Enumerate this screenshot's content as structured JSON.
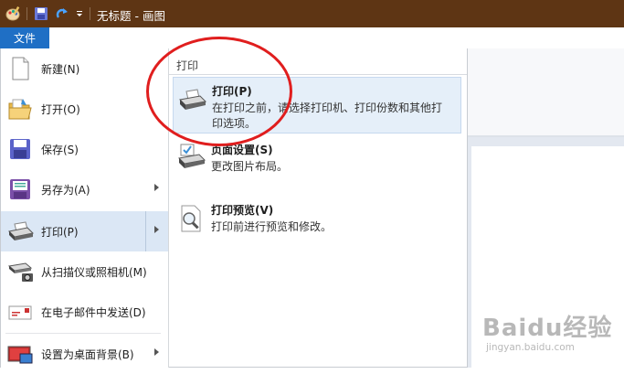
{
  "window": {
    "title": "无标题 - 画图"
  },
  "file_tab": {
    "label": "文件"
  },
  "menu_items": [
    {
      "label": "新建(N)",
      "icon": "new-document-icon"
    },
    {
      "label": "打开(O)",
      "icon": "open-folder-icon"
    },
    {
      "label": "保存(S)",
      "icon": "save-disk-icon"
    },
    {
      "label": "另存为(A)",
      "icon": "save-as-icon",
      "has_submenu": true
    },
    {
      "label": "打印(P)",
      "icon": "printer-icon",
      "has_submenu": true,
      "selected": true
    },
    {
      "label": "从扫描仪或照相机(M)",
      "icon": "scanner-camera-icon"
    },
    {
      "label": "在电子邮件中发送(D)",
      "icon": "email-icon"
    },
    {
      "label": "设置为桌面背景(B)",
      "icon": "desktop-background-icon",
      "has_submenu": true
    }
  ],
  "print_submenu": {
    "header": "打印",
    "items": [
      {
        "title": "打印(P)",
        "description": "在打印之前，请选择打印机、打印份数和其他打印选项。",
        "icon": "printer-icon",
        "highlighted": true
      },
      {
        "title": "页面设置(S)",
        "description": "更改图片布局。",
        "icon": "page-setup-icon"
      },
      {
        "title": "打印预览(V)",
        "description": "打印前进行预览和修改。",
        "icon": "print-preview-icon"
      }
    ]
  },
  "watermark": {
    "logo": "Baidu经验",
    "url": "jingyan.baidu.com"
  },
  "colors": {
    "titlebar": "#5e3514",
    "file_tab": "#1f6fc5",
    "selected_item": "#dbe7f5",
    "annotation_circle": "#e01e1e"
  }
}
